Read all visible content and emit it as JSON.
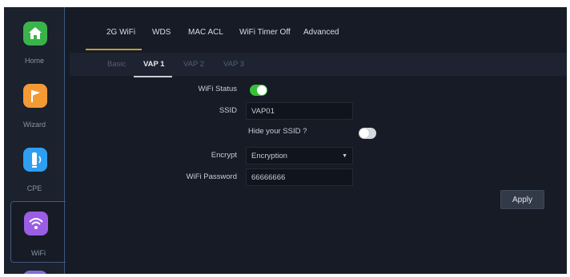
{
  "sidebar": {
    "items": [
      {
        "label": "Home",
        "icon": "home-icon",
        "color": "#3ab44a"
      },
      {
        "label": "Wizard",
        "icon": "flag-icon",
        "color": "#f39a35"
      },
      {
        "label": "CPE",
        "icon": "cpe-icon",
        "color": "#2e9ff0"
      },
      {
        "label": "WiFi",
        "icon": "wifi-icon",
        "color": "#9b5de5"
      }
    ],
    "active": "WiFi"
  },
  "tabs": [
    {
      "label": "2G WiFi",
      "active": true
    },
    {
      "label": "WDS"
    },
    {
      "label": "MAC ACL"
    },
    {
      "label": "WiFi Timer Off"
    },
    {
      "label": "Advanced"
    }
  ],
  "subtabs": [
    {
      "label": "Basic"
    },
    {
      "label": "VAP 1",
      "active": true
    },
    {
      "label": "VAP 2"
    },
    {
      "label": "VAP 3"
    }
  ],
  "form": {
    "wifi_status_label": "WiFi Status",
    "wifi_status_on": true,
    "ssid_label": "SSID",
    "ssid_value": "VAP01",
    "hide_ssid_label": "Hide your SSID ?",
    "hide_ssid_on": false,
    "encrypt_label": "Encrypt",
    "encrypt_value": "Encryption",
    "password_label": "WiFi Password",
    "password_value": "66666666"
  },
  "apply_label": "Apply",
  "colors": {
    "accent": "#c49a3c",
    "toggle_on": "#36c03a"
  }
}
